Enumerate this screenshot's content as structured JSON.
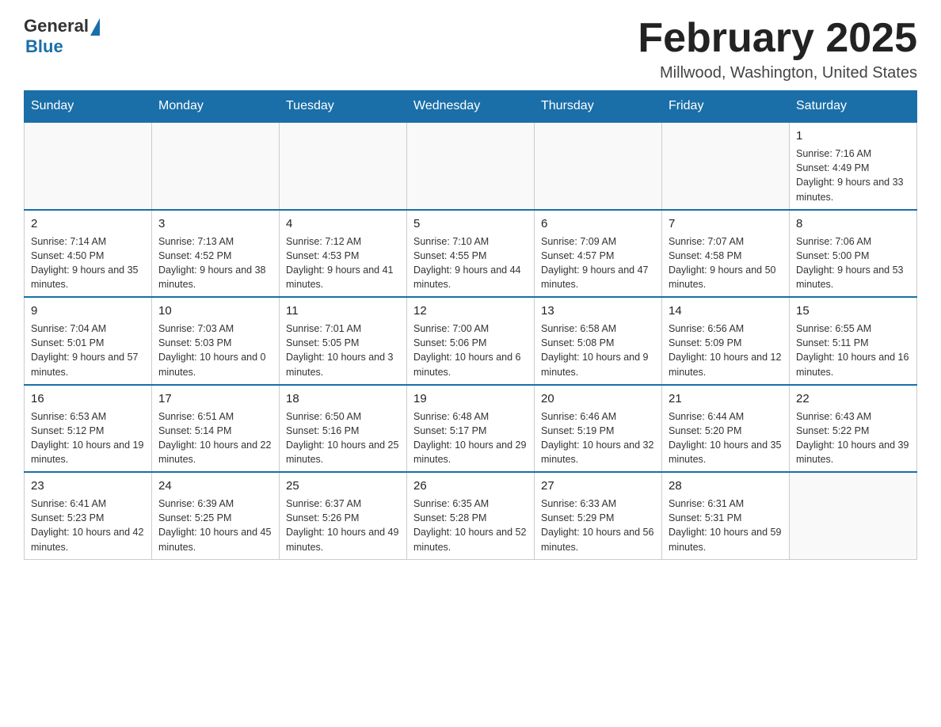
{
  "logo": {
    "general": "General",
    "blue": "Blue"
  },
  "header": {
    "title": "February 2025",
    "location": "Millwood, Washington, United States"
  },
  "weekdays": [
    "Sunday",
    "Monday",
    "Tuesday",
    "Wednesday",
    "Thursday",
    "Friday",
    "Saturday"
  ],
  "weeks": [
    [
      {
        "day": "",
        "info": ""
      },
      {
        "day": "",
        "info": ""
      },
      {
        "day": "",
        "info": ""
      },
      {
        "day": "",
        "info": ""
      },
      {
        "day": "",
        "info": ""
      },
      {
        "day": "",
        "info": ""
      },
      {
        "day": "1",
        "info": "Sunrise: 7:16 AM\nSunset: 4:49 PM\nDaylight: 9 hours and 33 minutes."
      }
    ],
    [
      {
        "day": "2",
        "info": "Sunrise: 7:14 AM\nSunset: 4:50 PM\nDaylight: 9 hours and 35 minutes."
      },
      {
        "day": "3",
        "info": "Sunrise: 7:13 AM\nSunset: 4:52 PM\nDaylight: 9 hours and 38 minutes."
      },
      {
        "day": "4",
        "info": "Sunrise: 7:12 AM\nSunset: 4:53 PM\nDaylight: 9 hours and 41 minutes."
      },
      {
        "day": "5",
        "info": "Sunrise: 7:10 AM\nSunset: 4:55 PM\nDaylight: 9 hours and 44 minutes."
      },
      {
        "day": "6",
        "info": "Sunrise: 7:09 AM\nSunset: 4:57 PM\nDaylight: 9 hours and 47 minutes."
      },
      {
        "day": "7",
        "info": "Sunrise: 7:07 AM\nSunset: 4:58 PM\nDaylight: 9 hours and 50 minutes."
      },
      {
        "day": "8",
        "info": "Sunrise: 7:06 AM\nSunset: 5:00 PM\nDaylight: 9 hours and 53 minutes."
      }
    ],
    [
      {
        "day": "9",
        "info": "Sunrise: 7:04 AM\nSunset: 5:01 PM\nDaylight: 9 hours and 57 minutes."
      },
      {
        "day": "10",
        "info": "Sunrise: 7:03 AM\nSunset: 5:03 PM\nDaylight: 10 hours and 0 minutes."
      },
      {
        "day": "11",
        "info": "Sunrise: 7:01 AM\nSunset: 5:05 PM\nDaylight: 10 hours and 3 minutes."
      },
      {
        "day": "12",
        "info": "Sunrise: 7:00 AM\nSunset: 5:06 PM\nDaylight: 10 hours and 6 minutes."
      },
      {
        "day": "13",
        "info": "Sunrise: 6:58 AM\nSunset: 5:08 PM\nDaylight: 10 hours and 9 minutes."
      },
      {
        "day": "14",
        "info": "Sunrise: 6:56 AM\nSunset: 5:09 PM\nDaylight: 10 hours and 12 minutes."
      },
      {
        "day": "15",
        "info": "Sunrise: 6:55 AM\nSunset: 5:11 PM\nDaylight: 10 hours and 16 minutes."
      }
    ],
    [
      {
        "day": "16",
        "info": "Sunrise: 6:53 AM\nSunset: 5:12 PM\nDaylight: 10 hours and 19 minutes."
      },
      {
        "day": "17",
        "info": "Sunrise: 6:51 AM\nSunset: 5:14 PM\nDaylight: 10 hours and 22 minutes."
      },
      {
        "day": "18",
        "info": "Sunrise: 6:50 AM\nSunset: 5:16 PM\nDaylight: 10 hours and 25 minutes."
      },
      {
        "day": "19",
        "info": "Sunrise: 6:48 AM\nSunset: 5:17 PM\nDaylight: 10 hours and 29 minutes."
      },
      {
        "day": "20",
        "info": "Sunrise: 6:46 AM\nSunset: 5:19 PM\nDaylight: 10 hours and 32 minutes."
      },
      {
        "day": "21",
        "info": "Sunrise: 6:44 AM\nSunset: 5:20 PM\nDaylight: 10 hours and 35 minutes."
      },
      {
        "day": "22",
        "info": "Sunrise: 6:43 AM\nSunset: 5:22 PM\nDaylight: 10 hours and 39 minutes."
      }
    ],
    [
      {
        "day": "23",
        "info": "Sunrise: 6:41 AM\nSunset: 5:23 PM\nDaylight: 10 hours and 42 minutes."
      },
      {
        "day": "24",
        "info": "Sunrise: 6:39 AM\nSunset: 5:25 PM\nDaylight: 10 hours and 45 minutes."
      },
      {
        "day": "25",
        "info": "Sunrise: 6:37 AM\nSunset: 5:26 PM\nDaylight: 10 hours and 49 minutes."
      },
      {
        "day": "26",
        "info": "Sunrise: 6:35 AM\nSunset: 5:28 PM\nDaylight: 10 hours and 52 minutes."
      },
      {
        "day": "27",
        "info": "Sunrise: 6:33 AM\nSunset: 5:29 PM\nDaylight: 10 hours and 56 minutes."
      },
      {
        "day": "28",
        "info": "Sunrise: 6:31 AM\nSunset: 5:31 PM\nDaylight: 10 hours and 59 minutes."
      },
      {
        "day": "",
        "info": ""
      }
    ]
  ]
}
